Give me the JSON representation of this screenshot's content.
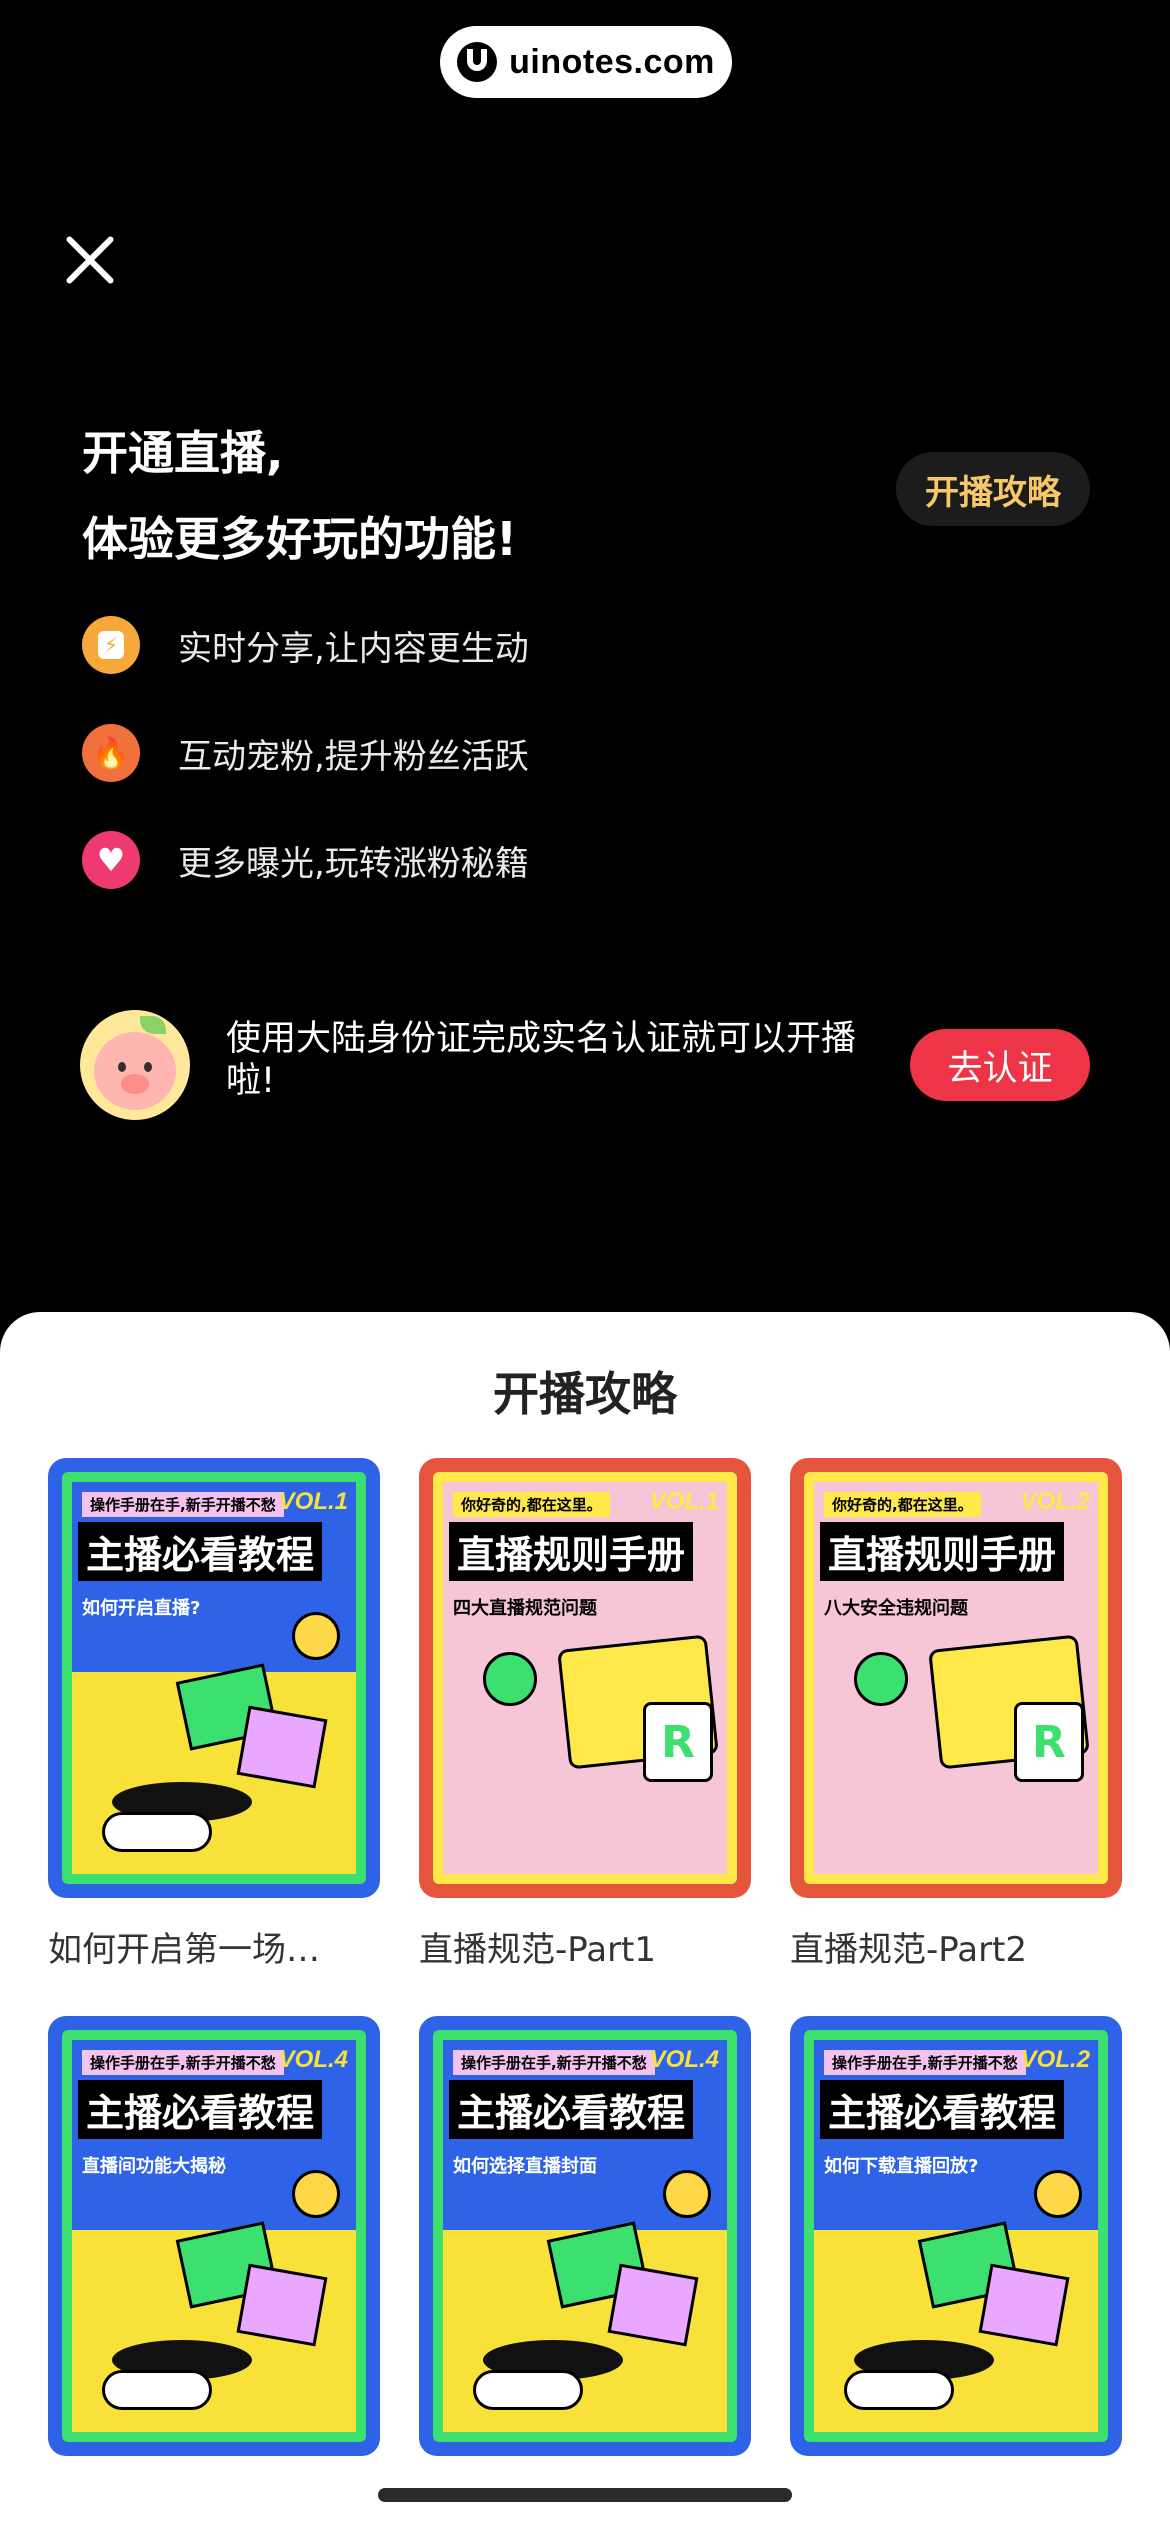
{
  "watermark": {
    "text": "uinotes.com"
  },
  "header": {
    "title_line1": "开通直播,",
    "title_line2": "体验更多好玩的功能!",
    "guide_button": "开播攻略"
  },
  "features": [
    {
      "label": "实时分享,让内容更生动",
      "icon": "lightning-icon"
    },
    {
      "label": "互动宠粉,提升粉丝活跃",
      "icon": "fire-icon"
    },
    {
      "label": "更多曝光,玩转涨粉秘籍",
      "icon": "heart-icon"
    }
  ],
  "verify": {
    "text": "使用大陆身份证完成实名认证就可以开播啦!",
    "button": "去认证"
  },
  "guide": {
    "title": "开播攻略",
    "cards": [
      {
        "label": "如何开启第一场…",
        "tag": "操作手册在手,新手开播不愁",
        "vol": "VOL.1",
        "headline": "主播必看教程",
        "sub": "如何开启直播?",
        "theme": "blue"
      },
      {
        "label": "直播规范-Part1",
        "tag": "你好奇的,都在这里。",
        "vol": "VOL.1",
        "headline": "直播规则手册",
        "sub": "四大直播规范问题",
        "theme": "red"
      },
      {
        "label": "直播规范-Part2",
        "tag": "你好奇的,都在这里。",
        "vol": "VOL.2",
        "headline": "直播规则手册",
        "sub": "八大安全违规问题",
        "theme": "red"
      },
      {
        "label": "",
        "tag": "操作手册在手,新手开播不愁",
        "vol": "VOL.4",
        "headline": "主播必看教程",
        "sub": "直播间功能大揭秘",
        "theme": "blue"
      },
      {
        "label": "",
        "tag": "操作手册在手,新手开播不愁",
        "vol": "VOL.4",
        "headline": "主播必看教程",
        "sub": "如何选择直播封面",
        "theme": "blue"
      },
      {
        "label": "",
        "tag": "操作手册在手,新手开播不愁",
        "vol": "VOL.2",
        "headline": "主播必看教程",
        "sub": "如何下载直播回放?",
        "theme": "blue"
      }
    ]
  }
}
